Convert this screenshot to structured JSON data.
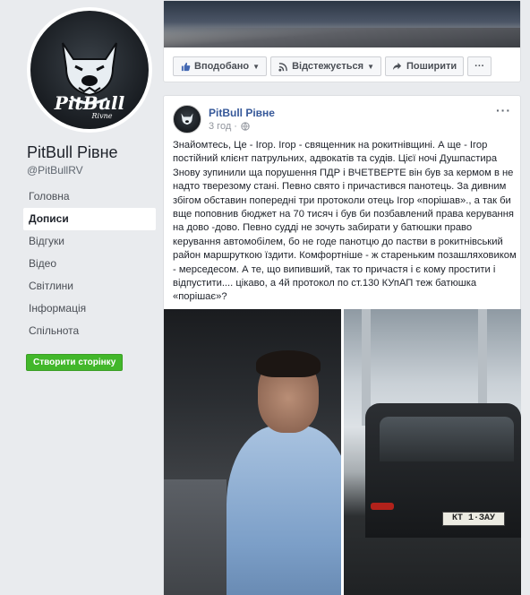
{
  "page": {
    "name": "PitBull Рівне",
    "handle": "@PitBullRV",
    "logo_text": "PitBull",
    "logo_subtext": "Rivne"
  },
  "nav": {
    "items": [
      "Головна",
      "Дописи",
      "Відгуки",
      "Відео",
      "Світлини",
      "Інформація",
      "Спільнота"
    ],
    "active": "Дописи"
  },
  "create_page_button": "Створити сторінку",
  "top_actions": {
    "liked": "Вподобано",
    "following": "Відстежується",
    "share": "Поширити",
    "more": "···"
  },
  "post": {
    "author": "PitBull Рівне",
    "time": "3 год",
    "more": "···",
    "text": "Знайомтесь, Це - Ігор. Ігор - священник на рокитнівщині. А ще - Ігор постійний клієнт патрульних, адвокатів та судів. Цієї ночі Душпастира Знову зупинили ща порушення ПДР і ВЧЕТВЕРТЕ він був за кермом в не надто тверезому стані. Певно свято і причастився панотець. За дивним збігом обставин попередні три протоколи отець Ігор «порішав»., а так би вще поповнив бюджет на 70 тисяч і був би позбавлений права керування на дово -дово. Певно судді не зочуть забирати у батюшки право керування автомобілем, бо не годе панотцю до пастви в рокитнівський район маршруткою їздити. Комфортніше - ж стареньким позашляховиком - мерседесом. А те, що випивший, так то причастя і є кому простити і відпустити.... цікаво, а 4й протокол по ст.130 КУпАП теж батюшка «порішає»?",
    "plate": "КТ 1·ЗАУ"
  },
  "colors": {
    "link": "#365899",
    "green": "#42b72a",
    "background": "#e9ebee"
  }
}
